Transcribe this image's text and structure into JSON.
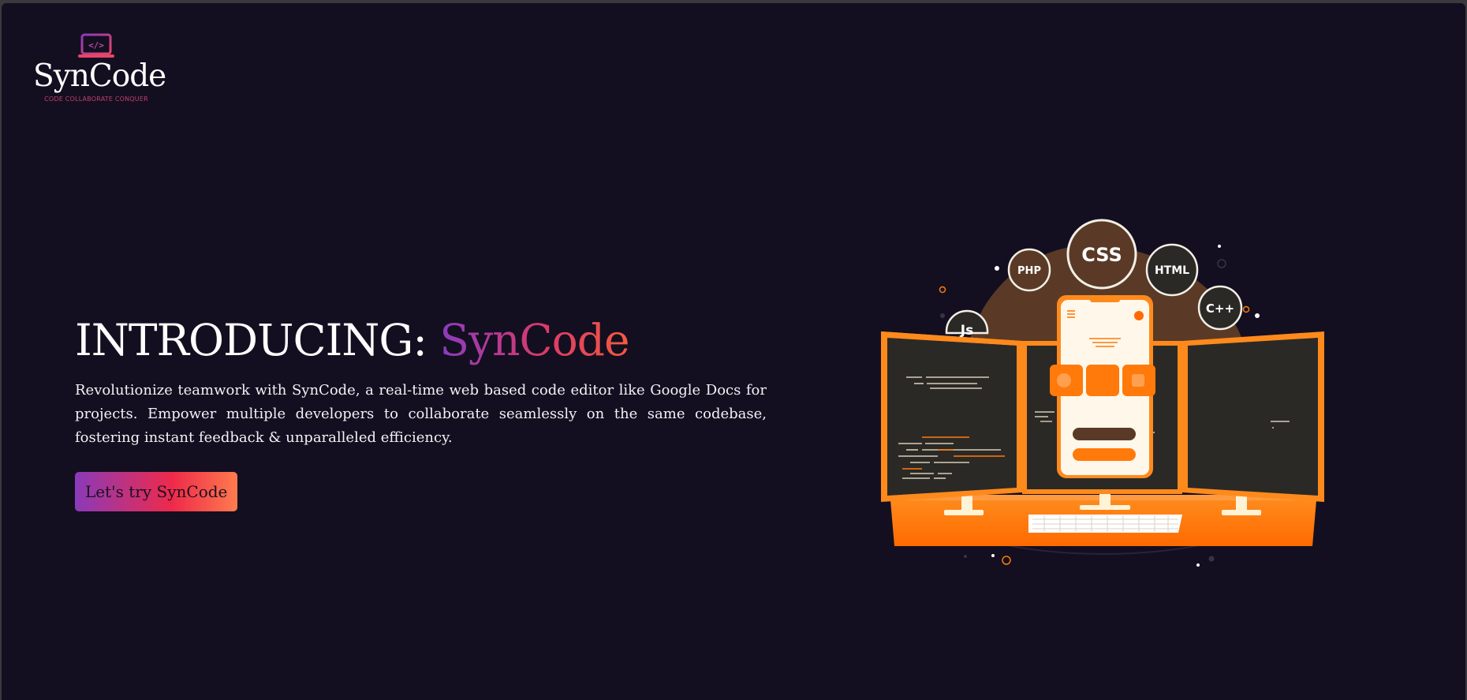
{
  "brand": {
    "icon": "laptop-code-icon",
    "name": "SynCode",
    "tagline": "CODE COLLABORATE CONQUER"
  },
  "hero": {
    "title_prefix": "INTRODUCING: ",
    "title_accent": "SynCode",
    "description": "Revolutionize teamwork with SynCode, a real-time web based code editor like Google Docs for projects. Empower multiple developers to collaborate seamlessly on the same codebase, fostering instant feedback & unparalleled efficiency.",
    "cta_label": "Let's try SynCode"
  },
  "illustration": {
    "badges": [
      "PHP",
      "CSS",
      "HTML",
      "C++",
      "Js"
    ]
  },
  "colors": {
    "background": "#130f20",
    "accent_orange": "#ff7a0a",
    "gradient_start": "#8a3ab9",
    "gradient_end": "#ff7b4e"
  }
}
